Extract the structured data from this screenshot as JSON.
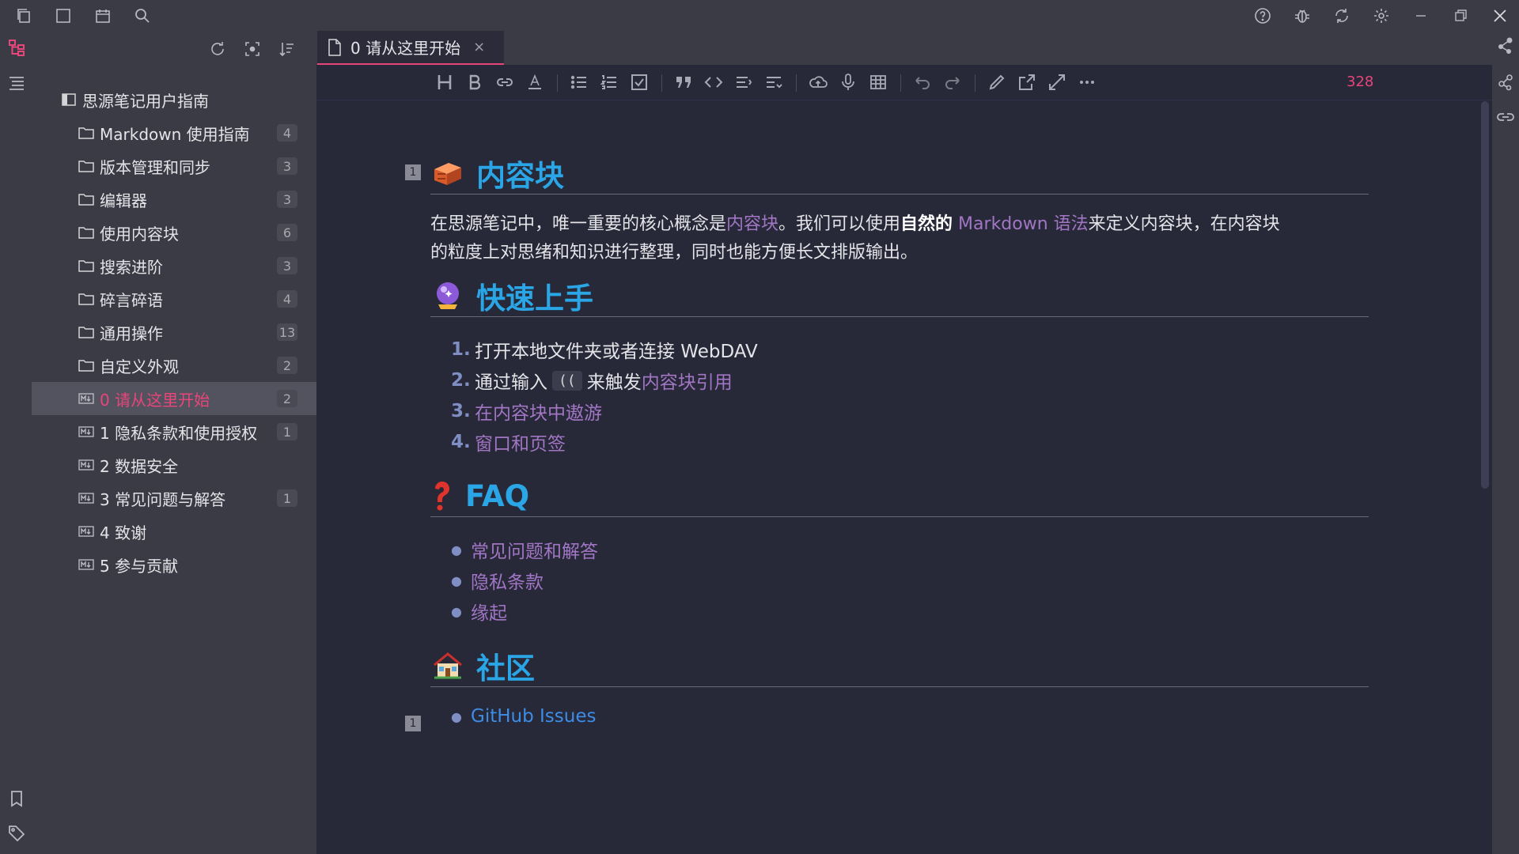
{
  "tab": {
    "title": "0 请从这里开始",
    "close": "×"
  },
  "sidebar": {
    "notebook": "思源笔记用户指南",
    "items": [
      {
        "label": "Markdown 使用指南",
        "count": "4"
      },
      {
        "label": "版本管理和同步",
        "count": "3"
      },
      {
        "label": "编辑器",
        "count": "3"
      },
      {
        "label": "使用内容块",
        "count": "6"
      },
      {
        "label": "搜索进阶",
        "count": "3"
      },
      {
        "label": "碎言碎语",
        "count": "4"
      },
      {
        "label": "通用操作",
        "count": "13"
      },
      {
        "label": "自定义外观",
        "count": "2"
      }
    ],
    "docs": [
      {
        "label": "0 请从这里开始",
        "count": "2"
      },
      {
        "label": "1 隐私条款和使用授权",
        "count": "1"
      },
      {
        "label": "2 数据安全",
        "count": ""
      },
      {
        "label": "3 常见问题与解答",
        "count": "1"
      },
      {
        "label": "4 致谢",
        "count": ""
      },
      {
        "label": "5 参与贡献",
        "count": ""
      }
    ]
  },
  "editor": {
    "word_count": "328",
    "block_marker": "1",
    "sections": {
      "content_block": "内容块",
      "quick_start": "快速上手",
      "faq": "FAQ",
      "community": "社区"
    },
    "intro": {
      "p1": "在思源笔记中，唯一重要的核心概念是",
      "link1": "内容块",
      "p2": "。我们可以使用",
      "bold": "自然的",
      "link2": " Markdown 语法",
      "p3": "来定义内容块，在内容块",
      "line2": "的粒度上对思绪和知识进行整理，同时也能方便长文排版输出。"
    },
    "quick_start_list": {
      "n1": "1.",
      "t1": "打开本地文件夹或者连接 WebDAV",
      "n2": "2.",
      "t2a": "通过输入",
      "code": "((",
      "t2b": "来触发",
      "t2link": "内容块引用",
      "n3": "3.",
      "t3": "在内容块中遨游",
      "n4": "4.",
      "t4": "窗口和页签"
    },
    "faq_list": [
      "常见问题和解答",
      "隐私条款",
      "缘起"
    ],
    "community_list": [
      "GitHub Issues"
    ]
  },
  "colors": {
    "accent": "#e8457a",
    "heading": "#2aa5e6",
    "link": "#a176c4",
    "editor_bg": "#272838",
    "panel_bg": "#3b3b45"
  }
}
